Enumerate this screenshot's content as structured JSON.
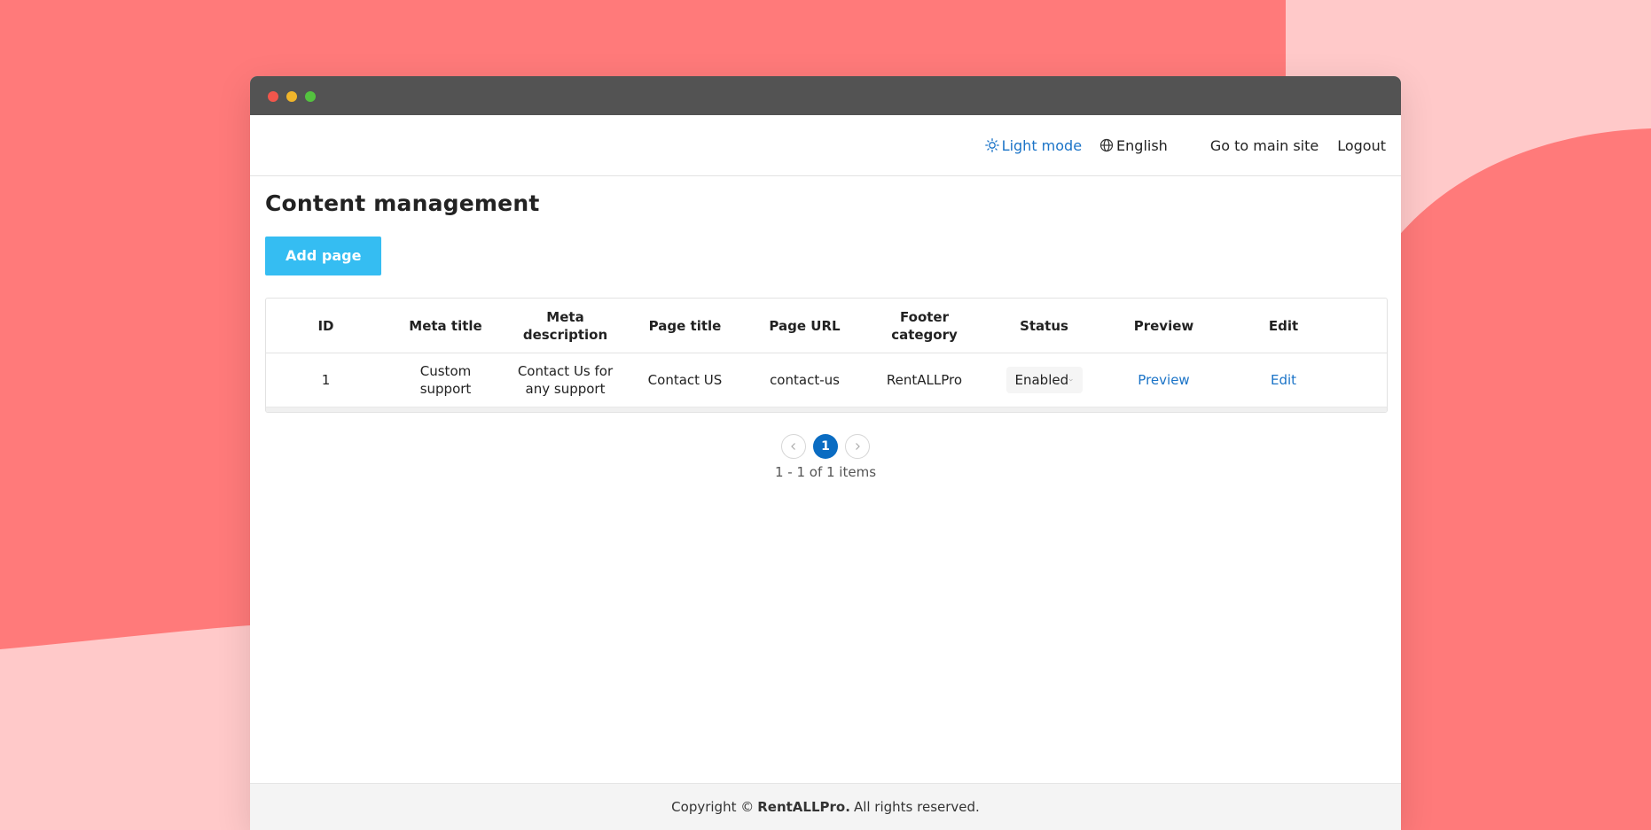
{
  "colors": {
    "background_coral": "#ff7a7a",
    "background_blob": "#ffc9c9",
    "titlebar": "#535353",
    "accent_link": "#1a73c7",
    "add_button": "#35bdf2",
    "active_page": "#0a6cc2"
  },
  "topnav": {
    "light_mode": "Light mode",
    "language": "English",
    "go_to_main_site": "Go to main site",
    "logout": "Logout"
  },
  "page": {
    "title": "Content management",
    "add_button": "Add page"
  },
  "table": {
    "headers": {
      "id": "ID",
      "meta_title": "Meta title",
      "meta_description_1": "Meta",
      "meta_description_2": "description",
      "page_title": "Page title",
      "page_url": "Page URL",
      "footer_category_1": "Footer",
      "footer_category_2": "category",
      "status": "Status",
      "preview": "Preview",
      "edit": "Edit"
    },
    "rows": [
      {
        "id": "1",
        "meta_title": "Custom support",
        "meta_description_1": "Contact Us for",
        "meta_description_2": "any support",
        "page_title": "Contact US",
        "page_url": "contact-us",
        "footer_category": "RentALLPro",
        "status": "Enabled",
        "preview": "Preview",
        "edit": "Edit"
      }
    ]
  },
  "pagination": {
    "current_page": "1",
    "range_text": "1 - 1 of 1 items"
  },
  "footer": {
    "prefix": "Copyright ©",
    "brand": "RentALLPro.",
    "suffix": "All rights reserved."
  }
}
